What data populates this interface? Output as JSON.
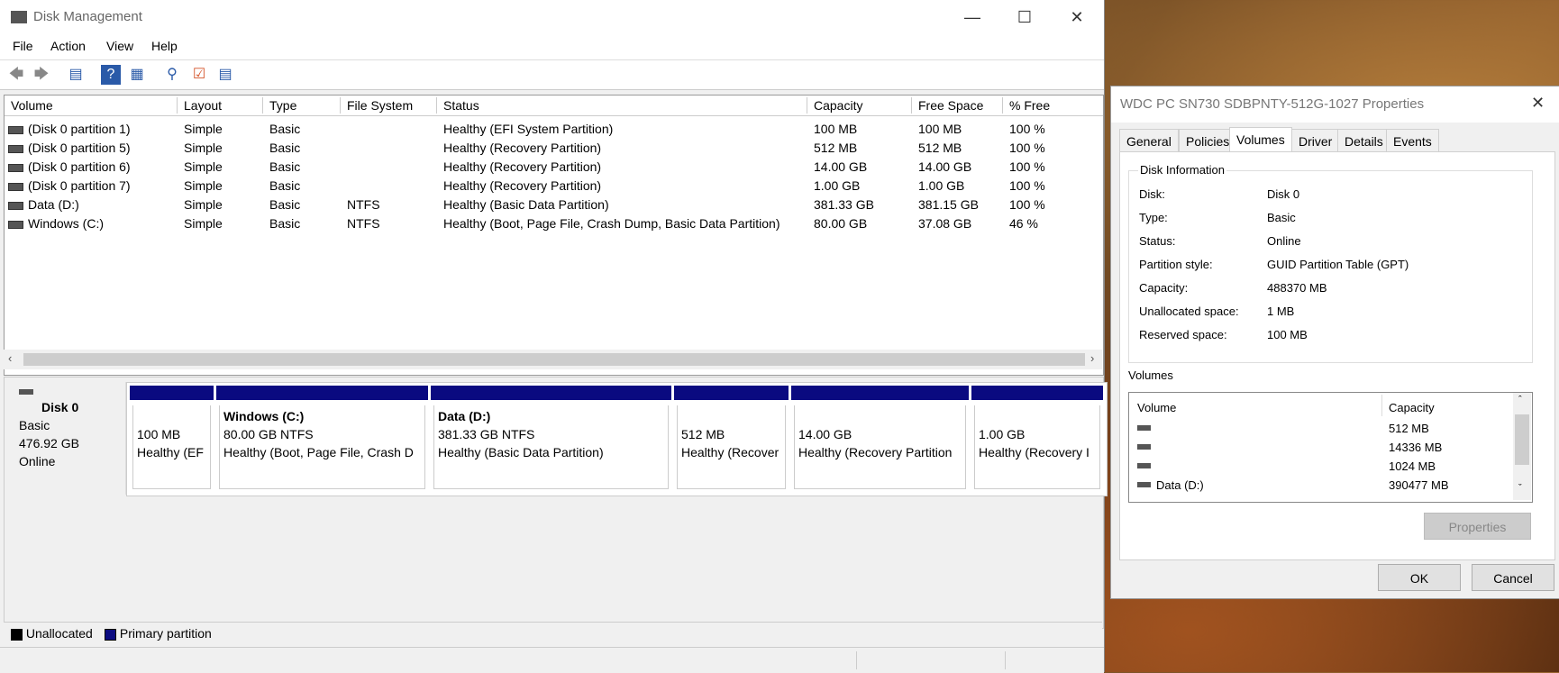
{
  "dm": {
    "title": "Disk Management",
    "menu": [
      "File",
      "Action",
      "View",
      "Help"
    ],
    "columns": [
      "Volume",
      "Layout",
      "Type",
      "File System",
      "Status",
      "Capacity",
      "Free Space",
      "% Free"
    ],
    "rows": [
      [
        "(Disk 0 partition 1)",
        "Simple",
        "Basic",
        "",
        "Healthy (EFI System Partition)",
        "100 MB",
        "100 MB",
        "100 %"
      ],
      [
        "(Disk 0 partition 5)",
        "Simple",
        "Basic",
        "",
        "Healthy (Recovery Partition)",
        "512 MB",
        "512 MB",
        "100 %"
      ],
      [
        "(Disk 0 partition 6)",
        "Simple",
        "Basic",
        "",
        "Healthy (Recovery Partition)",
        "14.00 GB",
        "14.00 GB",
        "100 %"
      ],
      [
        "(Disk 0 partition 7)",
        "Simple",
        "Basic",
        "",
        "Healthy (Recovery Partition)",
        "1.00 GB",
        "1.00 GB",
        "100 %"
      ],
      [
        "Data (D:)",
        "Simple",
        "Basic",
        "NTFS",
        "Healthy (Basic Data Partition)",
        "381.33 GB",
        "381.15 GB",
        "100 %"
      ],
      [
        "Windows (C:)",
        "Simple",
        "Basic",
        "NTFS",
        "Healthy (Boot, Page File, Crash Dump, Basic Data Partition)",
        "80.00 GB",
        "37.08 GB",
        "46 %"
      ]
    ],
    "disk": {
      "name": "Disk 0",
      "type": "Basic",
      "size": "476.92 GB",
      "status": "Online"
    },
    "partitions": [
      {
        "name": "",
        "size": "100 MB",
        "status": "Healthy (EF"
      },
      {
        "name": "Windows  (C:)",
        "size": "80.00 GB NTFS",
        "status": "Healthy (Boot, Page File, Crash D"
      },
      {
        "name": "Data  (D:)",
        "size": "381.33 GB NTFS",
        "status": "Healthy (Basic Data Partition)"
      },
      {
        "name": "",
        "size": "512 MB",
        "status": "Healthy (Recover"
      },
      {
        "name": "",
        "size": "14.00 GB",
        "status": "Healthy (Recovery Partition"
      },
      {
        "name": "",
        "size": "1.00 GB",
        "status": "Healthy (Recovery I"
      }
    ],
    "legend": {
      "unallocated": "Unallocated",
      "primary": "Primary partition"
    },
    "colors": {
      "primary": "#0a0a80",
      "unallocated": "#000000"
    }
  },
  "props": {
    "title": "WDC PC SN730 SDBPNTY-512G-1027 Properties",
    "tabs": [
      "General",
      "Policies",
      "Volumes",
      "Driver",
      "Details",
      "Events"
    ],
    "group_title": "Disk Information",
    "info": [
      [
        "Disk:",
        "Disk 0"
      ],
      [
        "Type:",
        "Basic"
      ],
      [
        "Status:",
        "Online"
      ],
      [
        "Partition style:",
        "GUID Partition Table (GPT)"
      ],
      [
        "Capacity:",
        "488370 MB"
      ],
      [
        "Unallocated space:",
        "1 MB"
      ],
      [
        "Reserved space:",
        "100 MB"
      ]
    ],
    "volumes_label": "Volumes",
    "volumes_cols": [
      "Volume",
      "Capacity"
    ],
    "volumes": [
      [
        "",
        "512 MB"
      ],
      [
        "",
        "14336 MB"
      ],
      [
        "",
        "1024 MB"
      ],
      [
        "Data (D:)",
        "390477 MB"
      ]
    ],
    "properties_btn": "Properties",
    "ok_btn": "OK",
    "cancel_btn": "Cancel"
  }
}
